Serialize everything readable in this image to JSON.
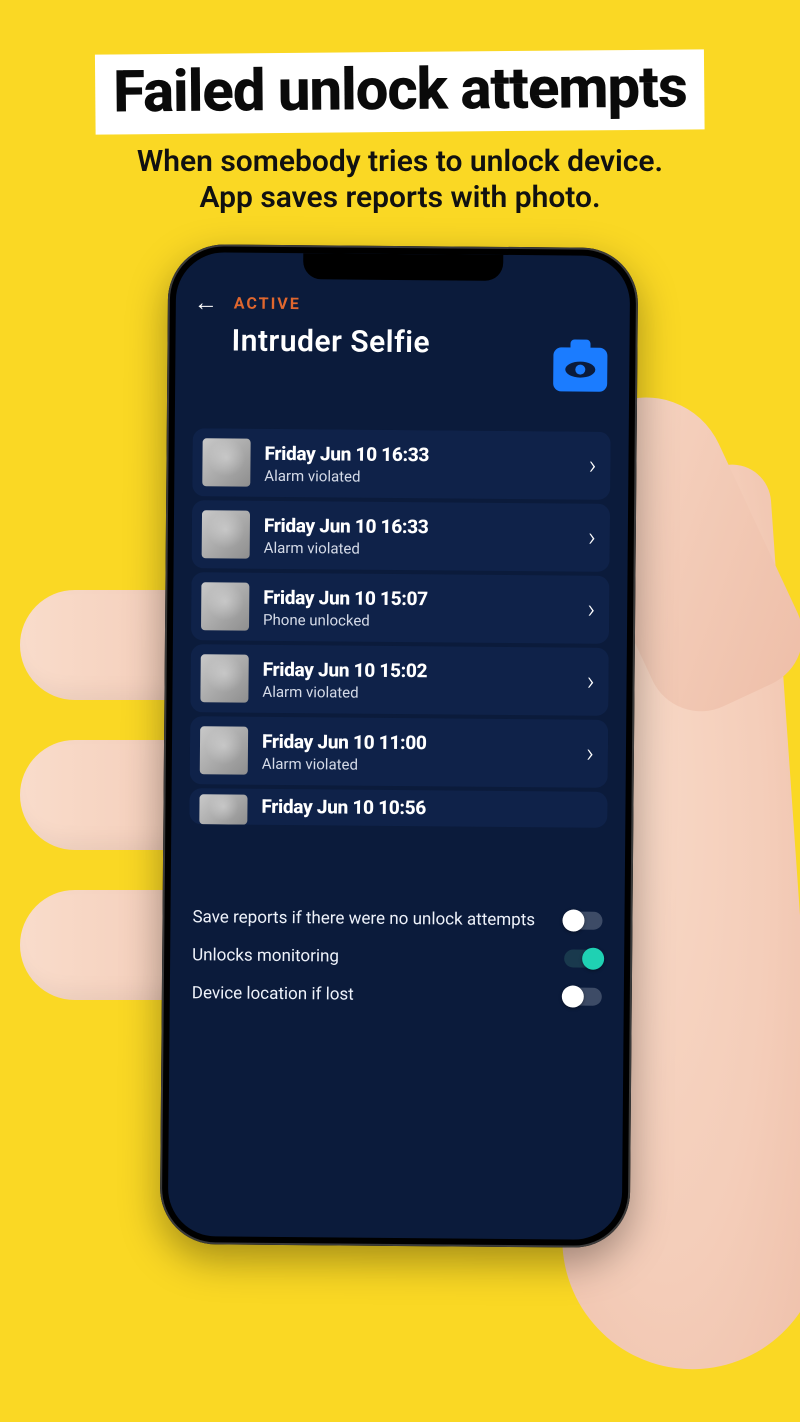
{
  "promo": {
    "title": "Failed unlock attempts",
    "subtitle1": "When somebody tries to unlock device.",
    "subtitle2": "App saves reports with photo."
  },
  "header": {
    "status": "ACTIVE",
    "title": "Intruder Selfie"
  },
  "reports": [
    {
      "time": "Friday Jun 10 16:33",
      "reason": "Alarm violated"
    },
    {
      "time": "Friday Jun 10 16:33",
      "reason": "Alarm violated"
    },
    {
      "time": "Friday Jun 10 15:07",
      "reason": "Phone unlocked"
    },
    {
      "time": "Friday Jun 10 15:02",
      "reason": "Alarm violated"
    },
    {
      "time": "Friday Jun 10 11:00",
      "reason": "Alarm violated"
    },
    {
      "time": "Friday Jun 10 10:56",
      "reason": ""
    }
  ],
  "settings": {
    "save_reports": {
      "label": "Save reports if there were no unlock attempts",
      "on": false
    },
    "unlocks_monitoring": {
      "label": "Unlocks monitoring",
      "on": true
    },
    "device_location": {
      "label": "Device location if lost",
      "on": false
    }
  }
}
